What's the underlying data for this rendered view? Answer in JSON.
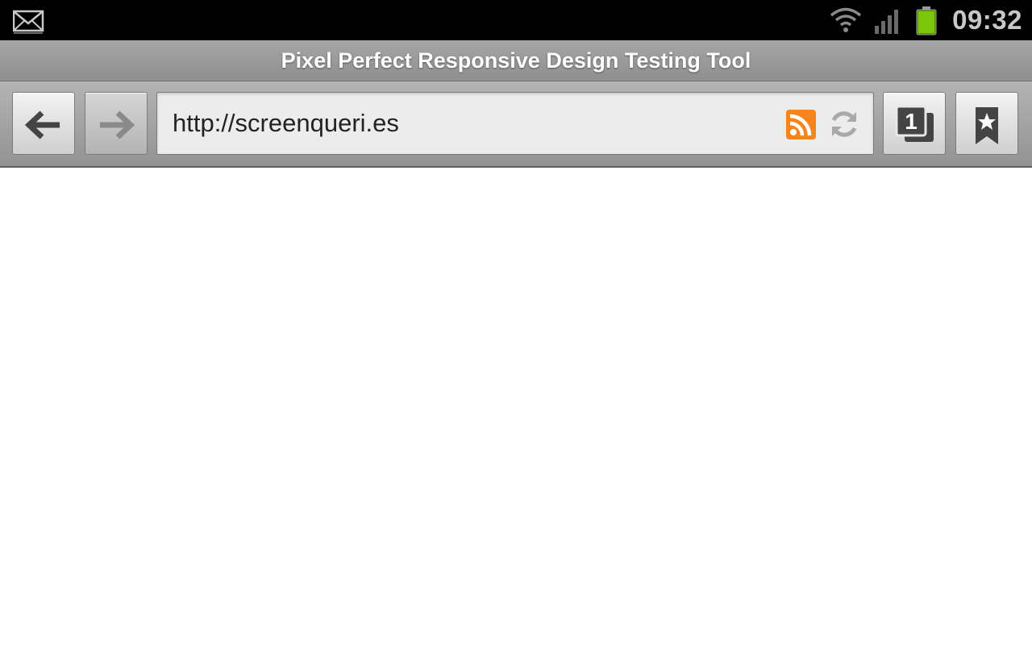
{
  "status_bar": {
    "time": "09:32",
    "notification_icon": "mail-icon",
    "wifi_icon": "wifi-icon",
    "signal_icon": "signal-icon",
    "battery_icon": "battery-icon",
    "battery_color": "#7ac70c"
  },
  "browser": {
    "page_title": "Pixel Perfect Responsive Design Testing Tool",
    "url": "http://screenqueri.es",
    "tab_count": "1",
    "rss_color": "#f7841d",
    "buttons": {
      "back_icon": "back-arrow-icon",
      "forward_icon": "forward-arrow-icon",
      "tabs_icon": "tabs-icon",
      "bookmark_icon": "bookmark-icon",
      "rss_icon": "rss-icon",
      "refresh_icon": "refresh-icon"
    }
  }
}
